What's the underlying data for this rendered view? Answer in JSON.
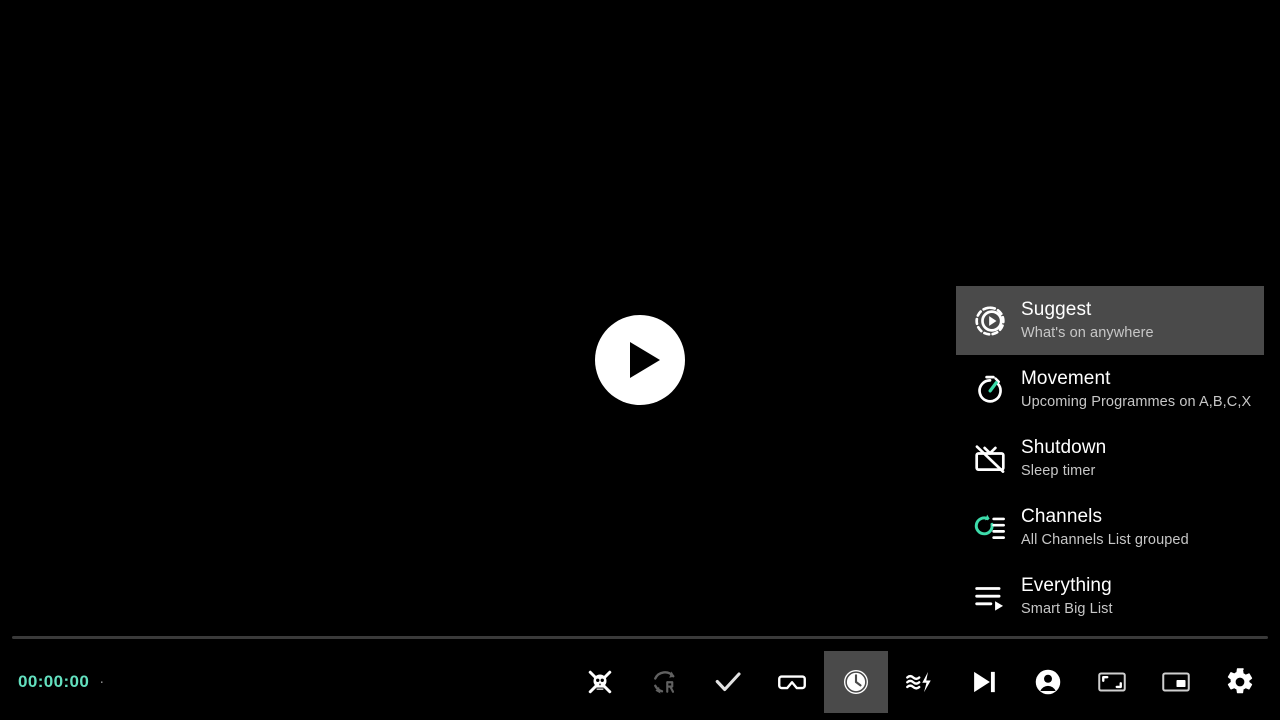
{
  "player": {
    "play_button_label": "Play",
    "play_icon": "play-circle-icon",
    "time_elapsed": "00:00:00",
    "time_separator": "·",
    "progress_percent": 0,
    "accent_color": "#63e0bf",
    "background_color": "#000000"
  },
  "side_menu": {
    "highlight_color": "#4a4a4a",
    "items": [
      {
        "title": "Suggest",
        "subtitle": "What's on anywhere",
        "icon": "play-in-dashed-circle-icon",
        "selected": true
      },
      {
        "title": "Movement",
        "subtitle": "Upcoming Programmes on A,B,C,X",
        "icon": "stopwatch-icon",
        "selected": false
      },
      {
        "title": "Shutdown",
        "subtitle": "Sleep timer",
        "icon": "tv-off-icon",
        "selected": false
      },
      {
        "title": "Channels",
        "subtitle": "All Channels List grouped",
        "icon": "refresh-list-icon",
        "selected": false
      },
      {
        "title": "Everything",
        "subtitle": "Smart Big List",
        "icon": "playlist-play-icon",
        "selected": false
      }
    ]
  },
  "toolbar": {
    "buttons": [
      {
        "label": "Skull",
        "icon": "skull-crossbones-icon",
        "active": false,
        "dim": false
      },
      {
        "label": "Rotation lock",
        "icon": "screen-rotation-icon",
        "active": false,
        "dim": true
      },
      {
        "label": "Check",
        "icon": "check-icon",
        "active": false,
        "dim": false
      },
      {
        "label": "VR mode",
        "icon": "vr-goggles-icon",
        "active": false,
        "dim": false
      },
      {
        "label": "Timer",
        "icon": "clock-icon",
        "active": true,
        "dim": false
      },
      {
        "label": "Speed",
        "icon": "waves-bolt-icon",
        "active": false,
        "dim": false
      },
      {
        "label": "Next",
        "icon": "skip-next-icon",
        "active": false,
        "dim": false
      },
      {
        "label": "Account",
        "icon": "account-circle-icon",
        "active": false,
        "dim": false
      },
      {
        "label": "Aspect ratio",
        "icon": "aspect-ratio-icon",
        "active": false,
        "dim": false
      },
      {
        "label": "Picture in picture",
        "icon": "pip-icon",
        "active": false,
        "dim": false
      },
      {
        "label": "Settings",
        "icon": "gear-icon",
        "active": false,
        "dim": false
      }
    ]
  }
}
